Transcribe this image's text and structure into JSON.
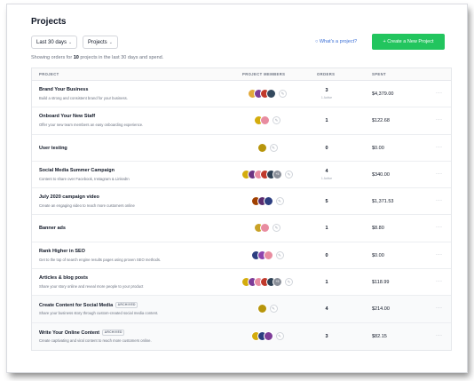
{
  "page": {
    "title": "Projects"
  },
  "filters": {
    "range": "Last 30 days",
    "type": "Projects"
  },
  "hint": "What's a project?",
  "cta": "+ Create a New Project",
  "summary": {
    "prefix": "Showing orders for",
    "count": "10",
    "suffix": "projects in the last 30 days and spend."
  },
  "columns": {
    "project": "PROJECT",
    "members": "PROJECT MEMBERS",
    "orders": "ORDERS",
    "spent": "SPENT"
  },
  "colors": {
    "accent": "#22c55e",
    "link": "#3b6fd6"
  },
  "rows": [
    {
      "name": "Brand Your Business",
      "desc": "Build a strong and consistent brand for your business.",
      "tag": "",
      "orders": "3",
      "active": "1 Active",
      "spent": "$4,379.00",
      "avatars": [
        "#e2a93b",
        "#7d3c98",
        "#c0392b",
        "#34495e"
      ],
      "more": ""
    },
    {
      "name": "Onboard Your New Staff",
      "desc": "Offer your new team members an easy onboarding experience.",
      "tag": "",
      "orders": "1",
      "active": "",
      "spent": "$122.68",
      "avatars": [
        "#d4ac0d",
        "#e88ca0"
      ],
      "more": ""
    },
    {
      "name": "User testing",
      "desc": "",
      "tag": "",
      "orders": "0",
      "active": "",
      "spent": "$0.00",
      "avatars": [
        "#b7950b"
      ],
      "more": ""
    },
    {
      "name": "Social Media Summer Campaign",
      "desc": "Content to share over Facebook, Instagram & LinkedIn",
      "tag": "",
      "orders": "4",
      "active": "1 Active",
      "spent": "$340.00",
      "avatars": [
        "#d4ac0d",
        "#6c3483",
        "#e88ca0",
        "#c0392b",
        "#2e4053"
      ],
      "more": "+5"
    },
    {
      "name": "July 2020 campaign video",
      "desc": "Create an engaging video to reach more customers online",
      "tag": "",
      "orders": "5",
      "active": "",
      "spent": "$1,371.53",
      "avatars": [
        "#a04000",
        "#5b2c6f",
        "#2c3e80"
      ],
      "more": ""
    },
    {
      "name": "Banner ads",
      "desc": "",
      "tag": "",
      "orders": "1",
      "active": "",
      "spent": "$8.80",
      "avatars": [
        "#c9a227",
        "#e88ca0"
      ],
      "more": ""
    },
    {
      "name": "Rank Higher in SEO",
      "desc": "Get to the top of search engine results pages using proven SEO methods.",
      "tag": "",
      "orders": "0",
      "active": "",
      "spent": "$0.00",
      "avatars": [
        "#2c3e80",
        "#8e44ad",
        "#e88ca0"
      ],
      "more": ""
    },
    {
      "name": "Articles & blog posts",
      "desc": "Share your story online and reveal more people to your product",
      "tag": "",
      "orders": "1",
      "active": "",
      "spent": "$118.99",
      "avatars": [
        "#d4ac0d",
        "#7d3c98",
        "#e88ca0",
        "#c0392b",
        "#2e4053"
      ],
      "more": "+5"
    },
    {
      "name": "Create Content for Social Media",
      "desc": "Share your business story through custom-created social media content.",
      "tag": "ARCHIVED",
      "orders": "4",
      "active": "",
      "spent": "$214.00",
      "avatars": [
        "#b7950b"
      ],
      "more": ""
    },
    {
      "name": "Write Your Online Content",
      "desc": "Create captivating and viral content to reach more customers online.",
      "tag": "ARCHIVED",
      "orders": "3",
      "active": "",
      "spent": "$82.15",
      "avatars": [
        "#d4ac0d",
        "#2c3e80",
        "#7d3c98"
      ],
      "more": ""
    }
  ]
}
